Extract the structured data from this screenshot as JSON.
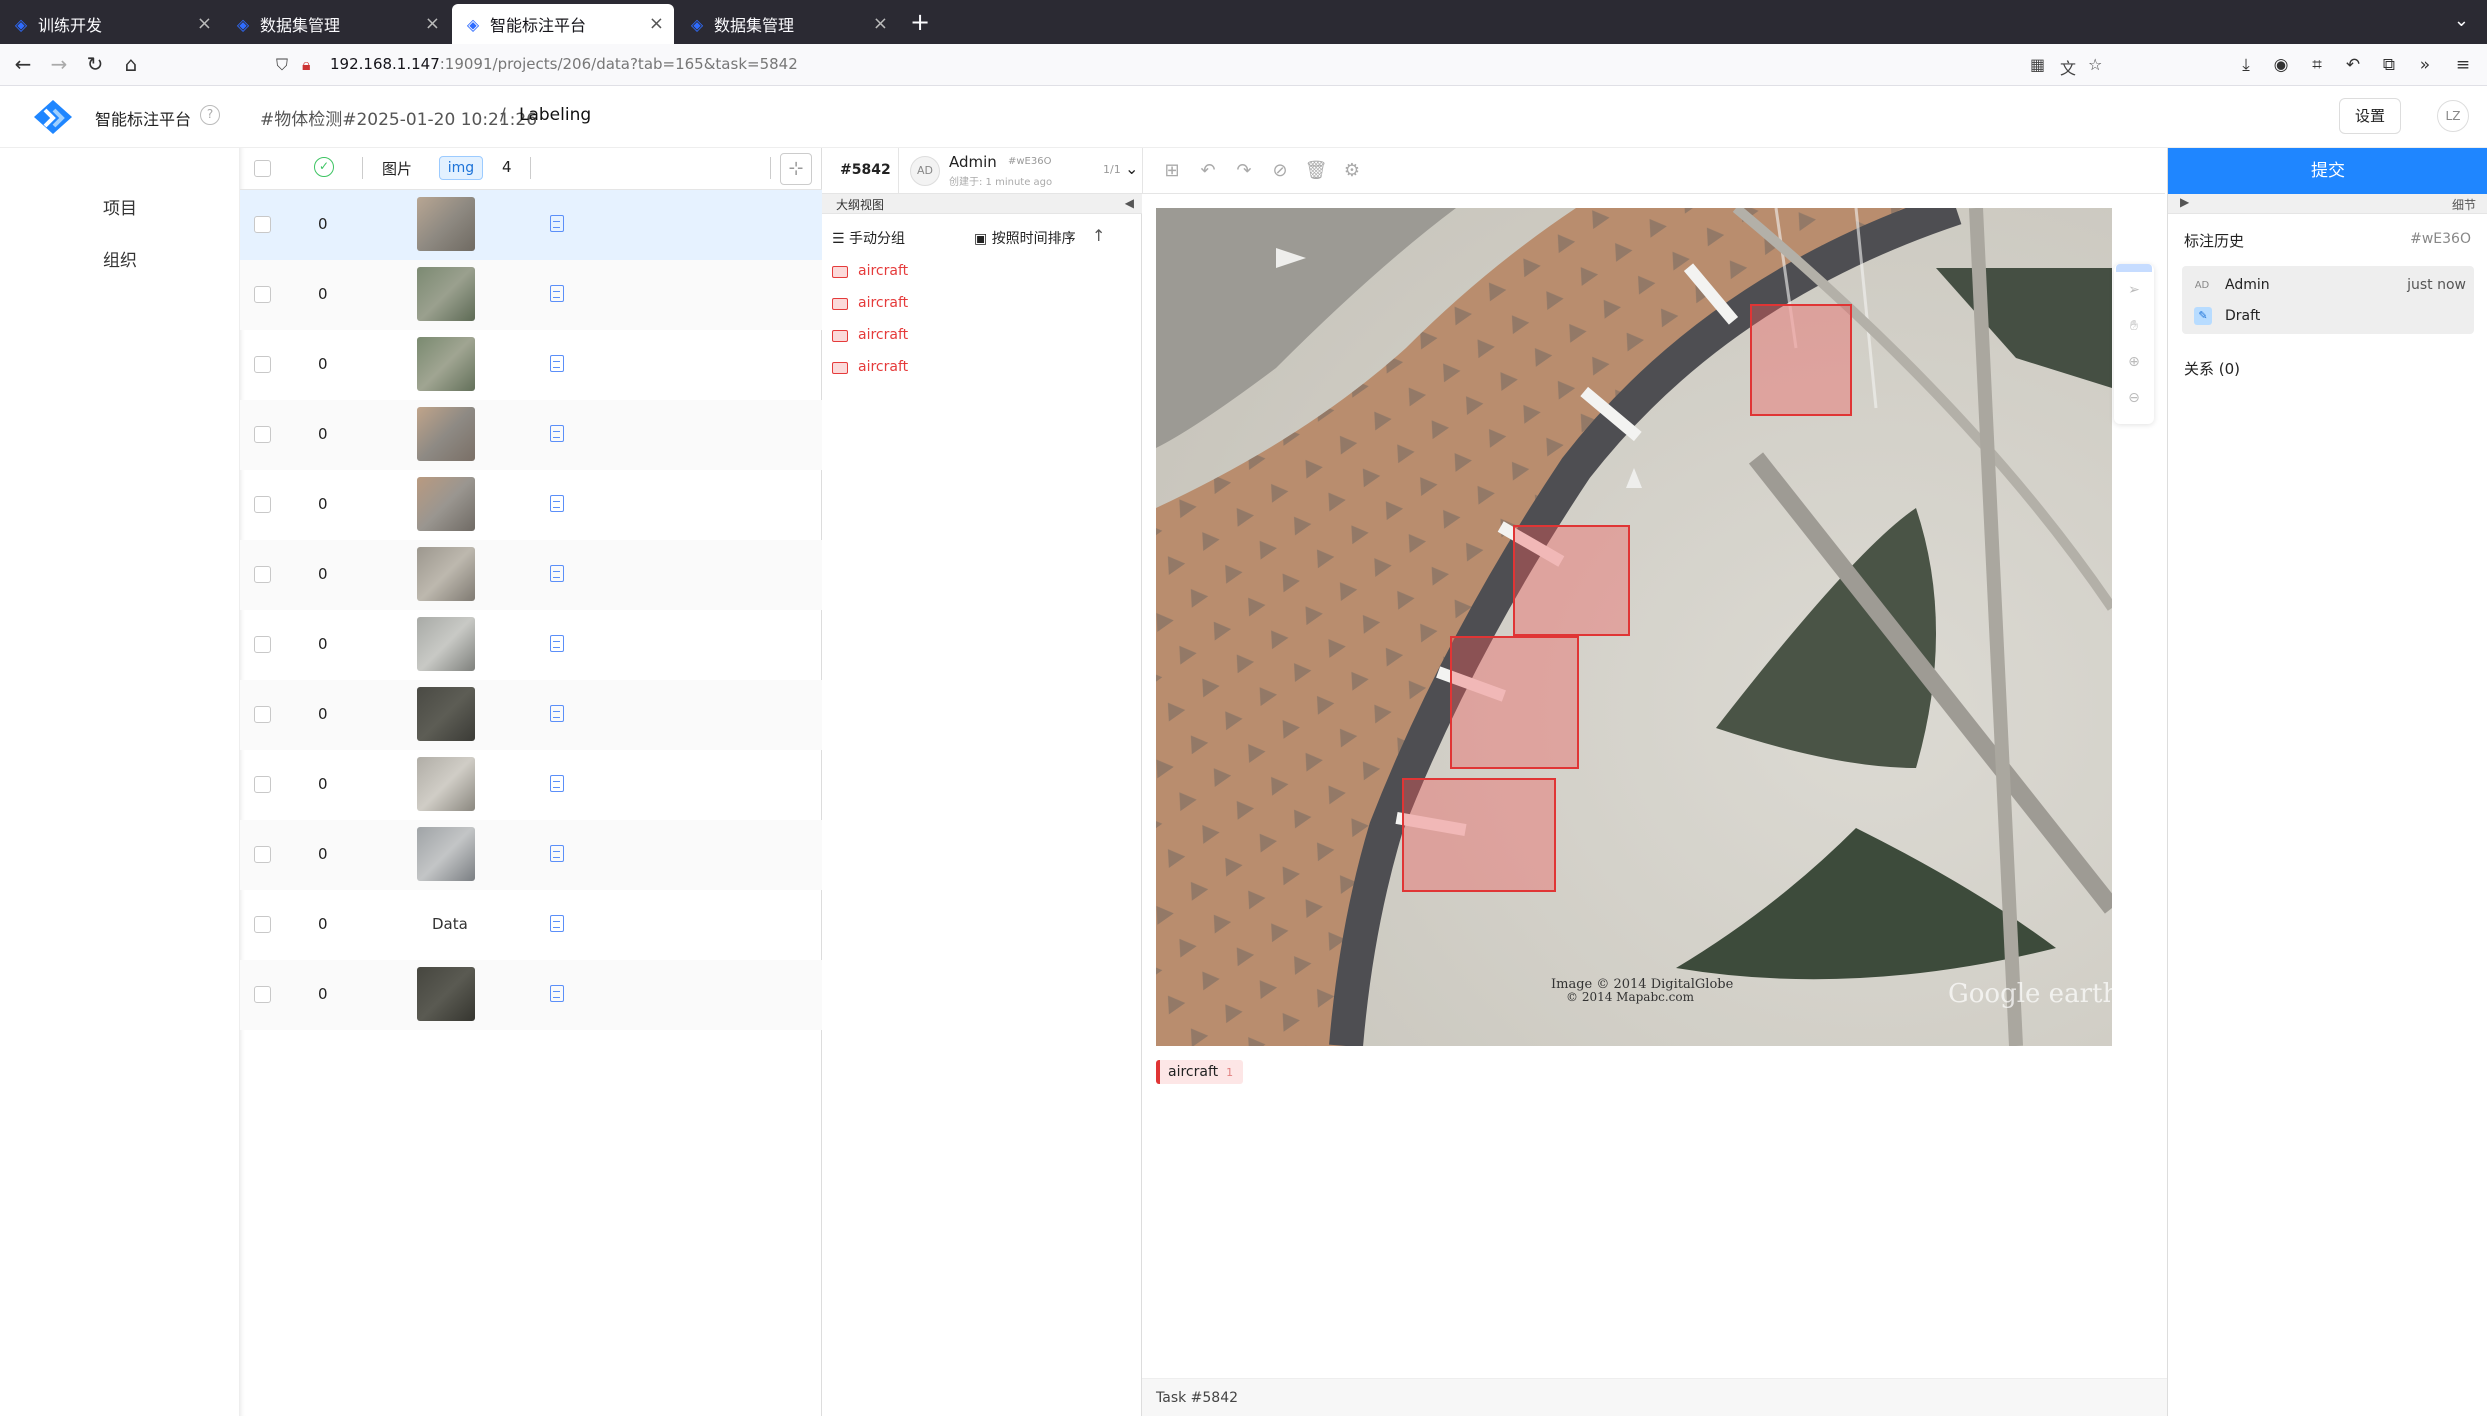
{
  "browser": {
    "tabs": [
      {
        "title": "训练开发",
        "active": false
      },
      {
        "title": "数据集管理",
        "active": false
      },
      {
        "title": "智能标注平台",
        "active": true
      },
      {
        "title": "数据集管理",
        "active": false
      }
    ],
    "url_host": "192.168.1.147",
    "url_rest": ":19091/projects/206/data?tab=165&task=5842"
  },
  "header": {
    "app_name": "智能标注平台",
    "breadcrumb_project": "#物体检测#2025-01-20 10:21:26",
    "breadcrumb_sep": "/",
    "breadcrumb_page": "Labeling",
    "settings_label": "设置",
    "user_initials": "LZ"
  },
  "leftnav": {
    "items": [
      {
        "label": "项目"
      },
      {
        "label": "组织"
      }
    ]
  },
  "datalist": {
    "header": {
      "image_col": "图片",
      "tag": "img",
      "count": "4"
    },
    "rows": [
      {
        "num": "0",
        "thumb": "img",
        "selected": true
      },
      {
        "num": "0",
        "thumb": "img"
      },
      {
        "num": "0",
        "thumb": "img"
      },
      {
        "num": "0",
        "thumb": "img"
      },
      {
        "num": "0",
        "thumb": "img"
      },
      {
        "num": "0",
        "thumb": "img"
      },
      {
        "num": "0",
        "thumb": "img"
      },
      {
        "num": "0",
        "thumb": "img"
      },
      {
        "num": "0",
        "thumb": "img"
      },
      {
        "num": "0",
        "thumb": "img"
      },
      {
        "num": "0",
        "thumb": "text",
        "text": "Data"
      },
      {
        "num": "0",
        "thumb": "img"
      }
    ]
  },
  "task": {
    "id": "#5842",
    "annotator_initials": "AD",
    "annotator": "Admin",
    "annotation_hash": "#wE36O",
    "created": "创建于: 1 minute ago",
    "count": "1/1"
  },
  "outline": {
    "title": "大纲视图",
    "group_label": "手动分组",
    "sort_label": "按照时间排序",
    "regions": [
      {
        "label": "aircraft"
      },
      {
        "label": "aircraft"
      },
      {
        "label": "aircraft"
      },
      {
        "label": "aircraft"
      }
    ]
  },
  "canvas": {
    "label_chip": "aircraft",
    "label_chip_count": "1",
    "footer": "Task #5842"
  },
  "right_panel": {
    "submit_label": "提交",
    "details_label": "细节",
    "history_title": "标注历史",
    "history_hash": "#wE36O",
    "history_user_initials": "AD",
    "history_user": "Admin",
    "history_when": "just now",
    "history_draft": "Draft",
    "relations_label": "关系 (0)"
  },
  "colors": {
    "accent": "#1f86ff",
    "region": "#e03535",
    "brand": "#2f6cff"
  }
}
